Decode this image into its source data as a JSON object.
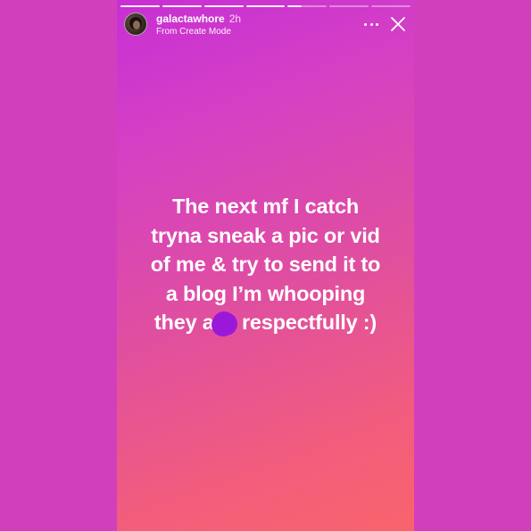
{
  "story": {
    "progress": {
      "segments_total": 7,
      "segments_viewed": 4,
      "current_segment_progress": 0.35
    },
    "header": {
      "username": "galactawhore",
      "time_ago": "2h",
      "subtitle": "From Create Mode",
      "more_icon": "more-horizontal-icon",
      "close_icon": "close-icon"
    },
    "caption": {
      "line1": "The next mf I catch",
      "line2": "tryna sneak a pic or vid",
      "line3": "of me & try to send it to",
      "line4": "a blog I’m whooping",
      "line5_before": "they a",
      "line5_after": " respectfully :)"
    },
    "colors": {
      "background": "#d23fbd",
      "gradient_top": "#c72fd4",
      "gradient_bottom": "#f9646c",
      "scribble": "#9a19d9"
    }
  }
}
